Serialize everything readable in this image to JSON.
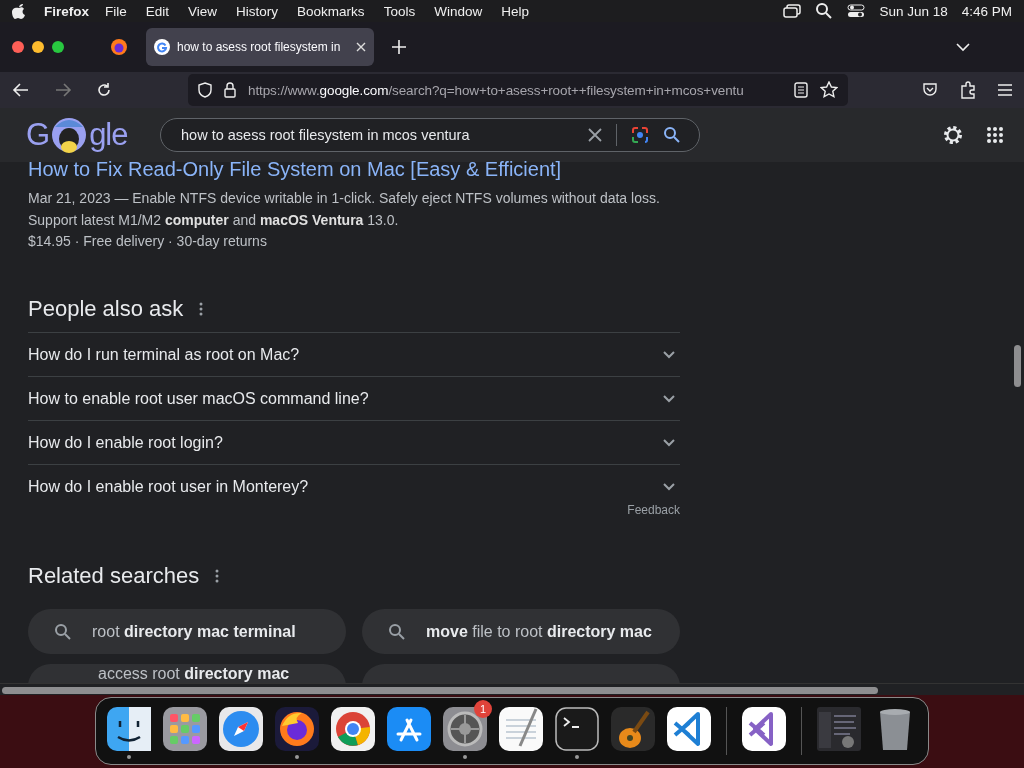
{
  "menubar": {
    "app": "Firefox",
    "menus": [
      "File",
      "Edit",
      "View",
      "History",
      "Bookmarks",
      "Tools",
      "Window",
      "Help"
    ],
    "date": "Sun Jun 18",
    "time": "4:46 PM"
  },
  "tabs": [
    {
      "title": "how to asess root filesystem in",
      "selected": true
    }
  ],
  "address_bar": {
    "prefix": "https://www.",
    "domain": "google.com",
    "rest": "/search?q=how+to+asess+root++filesystem+in+mcos+ventu"
  },
  "google": {
    "logo_left": "G",
    "logo_right": "gle",
    "query": "how to asess root filesystem in mcos ventura"
  },
  "result": {
    "title": "How to Fix Read-Only File System on Mac [Easy & Efficient]",
    "snippet": "Mar 21, 2023 — Enable NTFS device writable in 1-click. Safely eject NTFS volumes without data loss. Support latest M1/M2 **computer** and **macOS Ventura** 13.0.",
    "extras": "$14.95 · Free delivery · 30-day returns"
  },
  "people_also_ask": {
    "title": "People also ask",
    "questions": [
      {
        "text": "How do I run terminal as root on Mac?",
        "expanded": false
      },
      {
        "text": "How to enable root user macOS command line?",
        "expanded": false
      },
      {
        "text": "How do I enable root login?",
        "expanded": false
      },
      {
        "text": "How do I enable root user in Monterey?",
        "expanded": false
      }
    ],
    "feedback": "Feedback"
  },
  "related_searches": {
    "title": "Related searches",
    "items": [
      {
        "text": "root **directory mac terminal**"
      },
      {
        "text": "**move** file to root **directory mac**"
      },
      {
        "text": "access root **directory mac**"
      }
    ]
  },
  "dock": {
    "items": [
      {
        "kind": "finder",
        "running": true
      },
      {
        "kind": "launchpad",
        "running": false
      },
      {
        "kind": "safari",
        "running": false
      },
      {
        "kind": "firefox",
        "running": true
      },
      {
        "kind": "chrome",
        "running": false
      },
      {
        "kind": "appstore",
        "running": false
      },
      {
        "kind": "settings",
        "running": true,
        "badge": "1"
      },
      {
        "kind": "textedit",
        "running": false
      },
      {
        "kind": "terminal",
        "running": true
      },
      {
        "kind": "garageband",
        "running": false
      },
      {
        "kind": "vscode",
        "running": false
      },
      {
        "kind": "separator"
      },
      {
        "kind": "visualstudio",
        "running": false
      },
      {
        "kind": "separator"
      },
      {
        "kind": "window",
        "running": false
      },
      {
        "kind": "trash",
        "running": false
      }
    ]
  }
}
